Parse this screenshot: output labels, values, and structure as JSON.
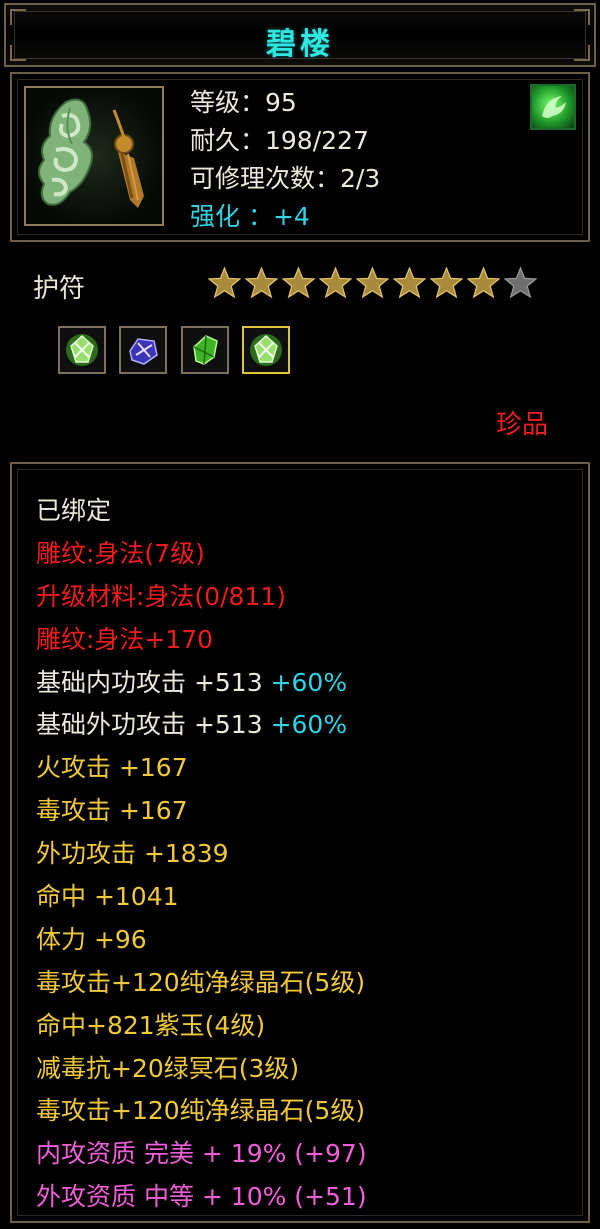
{
  "item": {
    "name": "碧楼",
    "icon": "jade-pendant-icon",
    "grade_icon": "green-dragon-grade-icon",
    "level_label": "等级：95",
    "durability_label": "耐久：198/227",
    "repair_label": "可修理次数：2/3",
    "enhance_label": "强化 ：+4"
  },
  "gems_section": {
    "type_label": "护符",
    "stars_filled": 8,
    "stars_total": 9,
    "slots": [
      {
        "icon": "green-crystal-gem-icon",
        "selected": false
      },
      {
        "icon": "purple-jade-gem-icon",
        "selected": false
      },
      {
        "icon": "green-stone-gem-icon",
        "selected": false
      },
      {
        "icon": "green-crystal-gem-icon",
        "selected": true
      }
    ],
    "rarity": "珍品"
  },
  "attributes": {
    "bound": "已绑定",
    "carving_level": "雕纹:身法(7级)",
    "upgrade_material": "升级材料:身法(0/811)",
    "carving_bonus": "雕纹:身法+170",
    "base_internal_attack": "基础内功攻击 +513",
    "base_internal_attack_pct": "+60%",
    "base_external_attack": "基础外功攻击 +513",
    "base_external_attack_pct": "+60%",
    "fire_attack": "火攻击 +167",
    "poison_attack": "毒攻击 +167",
    "external_attack": "外功攻击 +1839",
    "accuracy": "命中 +1041",
    "stamina": "体力 +96",
    "gem1": "毒攻击+120纯净绿晶石(5级)",
    "gem2": "命中+821紫玉(4级)",
    "gem3": "减毒抗+20绿冥石(3级)",
    "gem4": "毒攻击+120纯净绿晶石(5级)",
    "quality_internal": "内攻资质 完美 + 19% (+97)",
    "quality_external": "外攻资质 中等 + 10% (+51)"
  },
  "colors": {
    "title": "#2ee8e0",
    "enhance": "#2fd3e6",
    "red": "#ef1c1c",
    "gold": "#f0c83a",
    "pink": "#f05fd8",
    "border": "#6d5f46"
  }
}
